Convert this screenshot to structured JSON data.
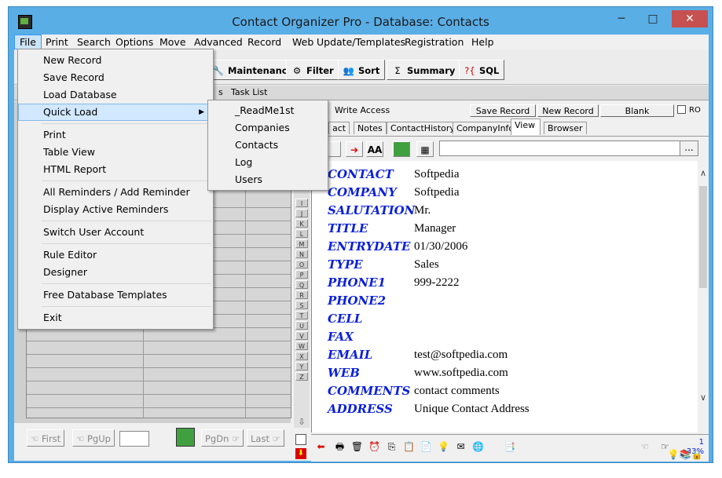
{
  "window": {
    "title": "Contact Organizer Pro - Database: Contacts",
    "minimize": "─",
    "maximize": "□",
    "close": "✕"
  },
  "menubar": [
    "File",
    "Print",
    "Search",
    "Options",
    "Move",
    "Advanced",
    "Record",
    "Web",
    "Update/Templates",
    "Registration",
    "Help"
  ],
  "toolbar": {
    "maintenance": "Maintenance",
    "filter": "Filter",
    "sort": "Sort",
    "summary": "Summary",
    "sql": "SQL"
  },
  "subtabs": {
    "partial": "s",
    "task_list": "Task List"
  },
  "status": {
    "write_access": "Write Access",
    "save_record": "Save Record",
    "new_record": "New Record",
    "blank": "Blank",
    "ro": "RO"
  },
  "tabs": [
    "act",
    "Notes",
    "ContactHistory",
    "CompanyInfo",
    "View",
    "Browser"
  ],
  "alphabet": [
    "I",
    "J",
    "K",
    "L",
    "M",
    "N",
    "O",
    "P",
    "Q",
    "R",
    "S",
    "T",
    "U",
    "V",
    "W",
    "X",
    "Y",
    "Z"
  ],
  "record": [
    {
      "label": "CONTACT",
      "value": "Softpedia"
    },
    {
      "label": "COMPANY",
      "value": "Softpedia"
    },
    {
      "label": "SALUTATION",
      "value": "Mr."
    },
    {
      "label": "TITLE",
      "value": "Manager"
    },
    {
      "label": "ENTRYDATE",
      "value": "01/30/2006"
    },
    {
      "label": "TYPE",
      "value": "Sales"
    },
    {
      "label": "PHONE1",
      "value": "999-2222"
    },
    {
      "label": "PHONE2",
      "value": ""
    },
    {
      "label": "CELL",
      "value": ""
    },
    {
      "label": "FAX",
      "value": ""
    },
    {
      "label": "EMAIL",
      "value": "test@softpedia.com"
    },
    {
      "label": "WEB",
      "value": "www.softpedia.com"
    },
    {
      "label": "COMMENTS",
      "value": "contact comments"
    },
    {
      "label": "ADDRESS",
      "value": "Unique Contact Address"
    }
  ],
  "nav": {
    "first": "First",
    "pgup": "PgUp",
    "pgdn": "PgDn",
    "last": "Last"
  },
  "zoom": {
    "page": "1",
    "percent": "33%"
  },
  "file_menu": {
    "new_record": "New Record",
    "save_record": "Save Record",
    "load_database": "Load Database",
    "quick_load": "Quick Load",
    "print": "Print",
    "table_view": "Table View",
    "html_report": "HTML Report",
    "all_reminders": "All Reminders / Add Reminder",
    "display_reminders": "Display Active Reminders",
    "switch_user": "Switch User Account",
    "rule_editor": "Rule Editor",
    "designer": "Designer",
    "free_templates": "Free Database Templates",
    "exit": "Exit"
  },
  "quick_load_menu": [
    "_ReadMe1st",
    "Companies",
    "Contacts",
    "Log",
    "Users"
  ],
  "colors": {
    "label_blue": "#0b20d8",
    "menu_highlight": "#d1e8ff",
    "frame": "#5aaee6"
  }
}
